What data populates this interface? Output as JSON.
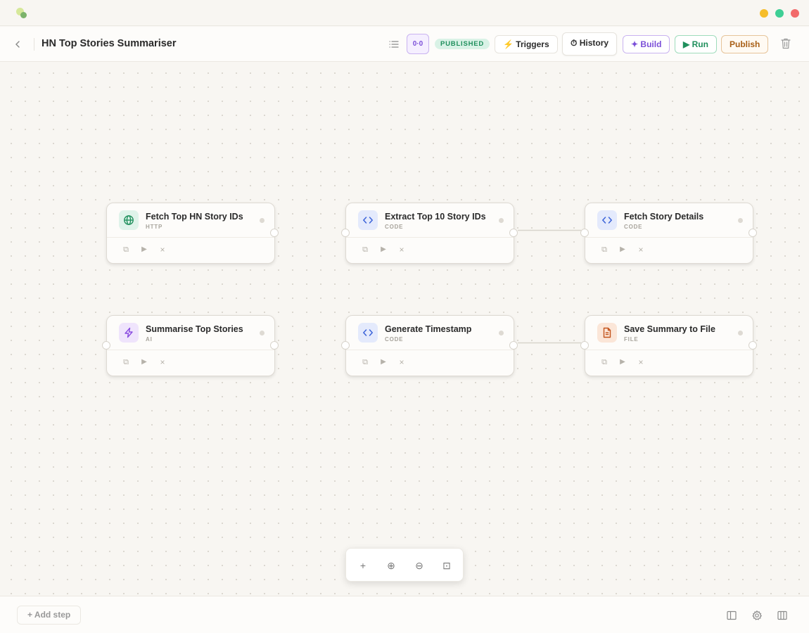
{
  "window": {
    "logo": "app-logo",
    "controls": [
      "minimize",
      "maximize",
      "close"
    ]
  },
  "header": {
    "back_icon": "chevron-left-icon",
    "title": "HN Top Stories Summariser",
    "node_count": "0·0",
    "status": "PUBLISHED",
    "buttons": {
      "triggers": {
        "icon": "⚡",
        "label": "Triggers"
      },
      "history": {
        "icon": "⏱",
        "label": "History"
      },
      "build": {
        "icon": "✦",
        "label": "Build"
      },
      "run": {
        "icon": "▶",
        "label": "Run"
      },
      "publish": {
        "label": "Publish"
      }
    }
  },
  "nodes": [
    {
      "title": "Fetch Top HN Story IDs",
      "type": "HTTP",
      "icon": "globe-icon"
    },
    {
      "title": "Extract Top 10 Story IDs",
      "type": "CODE",
      "icon": "code-icon"
    },
    {
      "title": "Fetch Story Details",
      "type": "CODE",
      "icon": "code-icon"
    },
    {
      "title": "Summarise Top Stories",
      "type": "AI",
      "icon": "lightning-icon"
    },
    {
      "title": "Generate Timestamp",
      "type": "CODE",
      "icon": "code-icon"
    },
    {
      "title": "Save Summary to File",
      "type": "FILE",
      "icon": "file-icon"
    }
  ],
  "node_actions": {
    "duplicate": "⧉",
    "run": "▶",
    "delete": "×"
  },
  "zoom": {
    "zoom_in": "+",
    "center": "⊕",
    "zoom_out": "⊖",
    "fit": "⊡"
  },
  "footer": {
    "add_step": "+ Add step"
  },
  "colors": {
    "accent_purple": "#7b4fd8",
    "accent_green": "#1f8f5c",
    "accent_orange": "#a85f16",
    "canvas_bg": "#f8f6f2"
  }
}
